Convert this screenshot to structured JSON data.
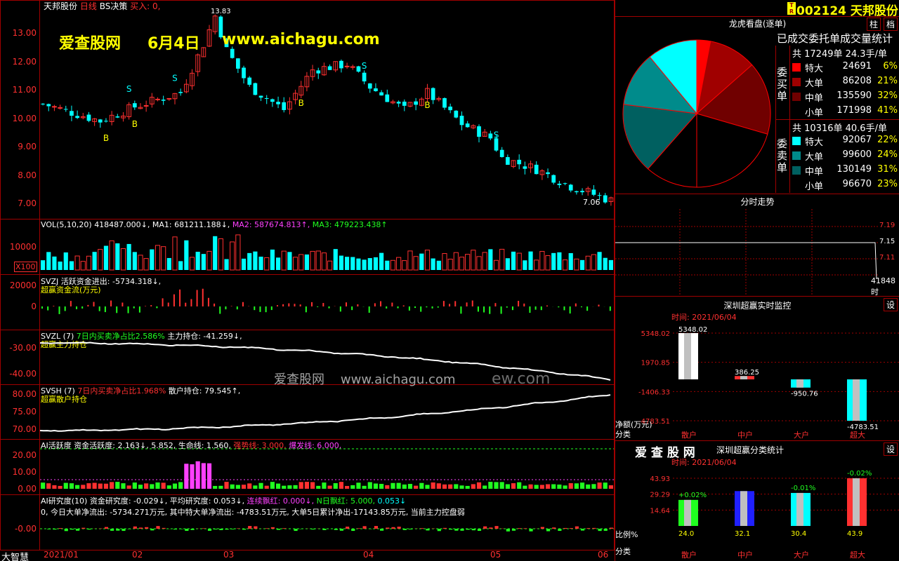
{
  "header": {
    "stock_name": "天邦股份",
    "period": "日线",
    "strategy": "BS决策",
    "buy_label": "买入: 0,",
    "max_price": "13.83",
    "code": "002124",
    "code_name": "天邦股份",
    "badge": "T R"
  },
  "watermark": {
    "site_name": "爱查股网",
    "date": "6月4日",
    "url": "www.aichagu.com",
    "mid_site": "爱查股网",
    "mid_url": "www.aichagu.com",
    "mid_tail": "ew.com",
    "rp_brand": "爱 查 股 网"
  },
  "main_chart": {
    "y_ticks": [
      "13.00",
      "12.00",
      "11.00",
      "10.00",
      "9.00",
      "8.00",
      "7.00"
    ],
    "last_price": "7.06",
    "markers_b": [
      "B",
      "B",
      "B",
      "B",
      "B",
      "B",
      "B"
    ],
    "markers_s": [
      "S",
      "S",
      "S",
      "S",
      "S"
    ],
    "colors": {
      "up": "#ff3030",
      "down": "#00ffff",
      "ma": "#ffffff"
    }
  },
  "vol": {
    "title": "VOL(5,10,20)",
    "value": "418487.000↓,",
    "ma1": "MA1: 681211.188↓,",
    "ma2": "MA2: 587674.813↑,",
    "ma3": "MA3: 479223.438↑",
    "y_tick": "10000",
    "unit": "X100"
  },
  "svzj": {
    "title": "SVZJ",
    "label": "活跃资金进出: -5734.318↓,",
    "sub": "超赢资金流(万元)",
    "y_ticks": [
      "20000",
      "0"
    ]
  },
  "svzl": {
    "title": "SVZL (7)",
    "label1": "7日内买卖净占比2.586%",
    "label2": "主力持仓: -41.259↓,",
    "sub": "超赢主力持仓",
    "y_ticks": [
      "-30.00",
      "-40.00"
    ]
  },
  "svsh": {
    "title": "SVSH (7)",
    "label1": "7日内买卖净占比1.968%",
    "label2": "散户持仓: 79.545↑,",
    "sub": "超赢散户持仓",
    "y_ticks": [
      "80.00",
      "75.00",
      "70.00"
    ]
  },
  "ai_active": {
    "title": "AI活跃度",
    "label1": "资金活跃度: 2.163↓,",
    "label2": "5.852,",
    "label3": "生命线: 1.560,",
    "label4": "强势线: 3.000,",
    "label5": "爆发线: 6.000,",
    "y_ticks": [
      "20.00",
      "10.00",
      "0.00"
    ]
  },
  "ai_research": {
    "title": "AI研究度(10)",
    "label1": "资金研究度: -0.029↓,",
    "label2": "平均研究度: 0.053↓,",
    "label3": "连续飘红: 0.000↓,",
    "label4": "N日飘红: 5.000,",
    "label5": "0.053↓",
    "desc": "0, 今日大单净流出: -5734.271万元, 其中特大单净流出: -4783.51万元, 大单5日累计净出-17143.85万元, 当前主力控盘弱",
    "y_tick": "-0.00",
    "footer": "大智慧"
  },
  "x_axis": [
    "2021/01",
    "02",
    "03",
    "04",
    "05",
    "06"
  ],
  "right_panel": {
    "buttons": [
      "柱",
      "档"
    ],
    "pie_title": "龙虎看盘(逐单)",
    "stats_title": "已成交委托单成交量统计",
    "buy_side": "委买单",
    "sell_side": "委卖单",
    "buy_total": "共 17249单 24.3手/单",
    "sell_total": "共 10316单 40.6手/单",
    "buy_rows": [
      {
        "label": "特大",
        "count": "24691",
        "pct": "6%",
        "color": "#ff0000"
      },
      {
        "label": "大单",
        "count": "86208",
        "pct": "21%",
        "color": "#a00000"
      },
      {
        "label": "中单",
        "count": "135590",
        "pct": "32%",
        "color": "#700000"
      },
      {
        "label": "小单",
        "count": "171998",
        "pct": "41%",
        "color": "#000000"
      }
    ],
    "sell_rows": [
      {
        "label": "特大",
        "count": "92067",
        "pct": "22%",
        "color": "#00ffff"
      },
      {
        "label": "大单",
        "count": "99600",
        "pct": "24%",
        "color": "#008b8b"
      },
      {
        "label": "中单",
        "count": "130149",
        "pct": "31%",
        "color": "#006060"
      },
      {
        "label": "小单",
        "count": "96670",
        "pct": "23%",
        "color": "#000000"
      }
    ],
    "pie_shares": [
      6,
      21,
      32,
      41,
      23,
      31,
      24,
      22
    ],
    "intraday": {
      "title": "分时走势",
      "ticks": [
        "7.19",
        "7.15",
        "7.11"
      ],
      "footer": "41848",
      "footer2": "时"
    },
    "monitor": {
      "title": "深圳超赢实时监控",
      "button": "设",
      "time": "时间: 2021/06/04",
      "y_ticks": [
        "5348.02",
        "1970.85",
        "-1406.33",
        "-4783.51"
      ],
      "y_label": "净额(万元)",
      "x_label": "分类",
      "categories": [
        "散户",
        "中户",
        "大户",
        "超大"
      ],
      "values": [
        5348.02,
        386.25,
        -950.76,
        -4783.51
      ],
      "value_labels": [
        "5348.02",
        "386.25",
        "-950.76",
        "-4783.51"
      ]
    },
    "category": {
      "title": "深圳超赢分类统计",
      "button": "设",
      "time": "时间: 2021/06/04",
      "y_ticks": [
        "43.93",
        "29.29",
        "14.64"
      ],
      "y_label": "比例%",
      "x_label": "分类",
      "categories": [
        "散户",
        "中户",
        "大户",
        "超大"
      ],
      "values": [
        24.0,
        32.1,
        30.4,
        43.9
      ],
      "value_labels": [
        "24.0",
        "32.1",
        "30.4",
        "43.9"
      ],
      "change_labels": [
        "+0.02%",
        "",
        "-0.01%",
        "-0.02%"
      ],
      "colors": [
        "#20ff20",
        "#2020ff",
        "#00ffff",
        "#ff3030"
      ]
    }
  }
}
